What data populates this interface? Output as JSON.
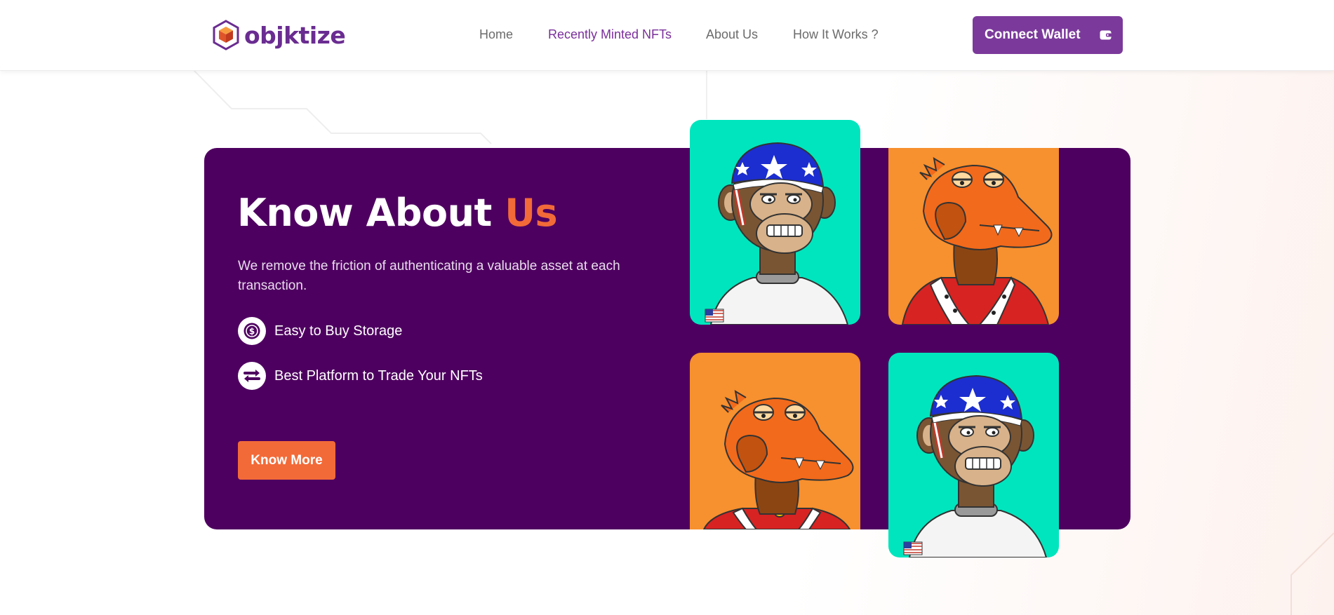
{
  "brand": {
    "name": "objktize",
    "logo_icon": "cube-hexagon-icon"
  },
  "nav": {
    "items": [
      {
        "label": "Home",
        "active": false
      },
      {
        "label": "Recently Minted NFTs",
        "active": true
      },
      {
        "label": "About Us",
        "active": false
      },
      {
        "label": "How It Works ?",
        "active": false
      }
    ]
  },
  "header": {
    "connect_label": "Connect Wallet",
    "connect_icon": "wallet-icon"
  },
  "hero": {
    "title_main": "Know About",
    "title_accent": "Us",
    "description": "We remove the friction of authenticating a valuable asset at each transaction.",
    "features": [
      {
        "label": "Easy to Buy Storage",
        "icon": "dollar-icon"
      },
      {
        "label": "Best Platform to Trade Your NFTs",
        "icon": "swap-arrows-icon"
      }
    ],
    "cta_label": "Know More"
  },
  "gallery": {
    "tiles": [
      {
        "name": "astronaut-ape",
        "bg": "#00e5bd"
      },
      {
        "name": "croc-king",
        "bg": "#f7902e"
      },
      {
        "name": "croc-king",
        "bg": "#f7902e"
      },
      {
        "name": "astronaut-ape",
        "bg": "#00e5bd"
      }
    ]
  },
  "colors": {
    "brand_purple": "#7b3a9b",
    "card_purple": "#4e0060",
    "accent_orange": "#f26a38",
    "teal": "#00e5bd",
    "orange_tile": "#f7902e"
  }
}
